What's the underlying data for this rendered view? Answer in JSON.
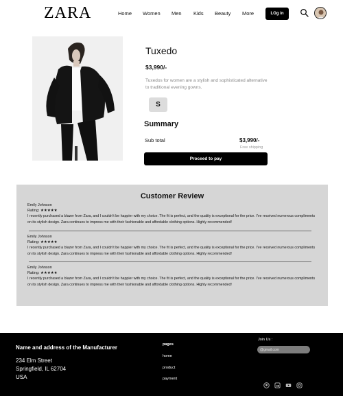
{
  "header": {
    "logo": "ZARA",
    "nav": [
      {
        "label": "Home"
      },
      {
        "label": "Women"
      },
      {
        "label": "Men"
      },
      {
        "label": "Kids"
      },
      {
        "label": "Beauty"
      },
      {
        "label": "More"
      }
    ],
    "login_label": "LOg in",
    "icons": {
      "search": "search-icon",
      "avatar": "avatar"
    }
  },
  "product": {
    "title": "Tuxedo",
    "price": "$3,990/-",
    "description": "Tuxedos for women are a stylish and sophisticated alternative to traditional evening gowns.",
    "size": "S"
  },
  "summary": {
    "title": "Summary",
    "subtotal_label": "Sub total",
    "subtotal_value": "$3,990/-",
    "shipping": "Free shipping",
    "proceed_label": "Proceed to  pay"
  },
  "reviews": {
    "title": "Customer Review",
    "items": [
      {
        "name": "Emily Johnson",
        "rating": "Rating: ★★★★★",
        "text": "I recently purchased a blazer from Zara, and I couldn't be happier with my choice. The fit is perfect, and the quality is exceptional for the price. I've received numerous compliments on its stylish design. Zara continues to impress me with their fashionable and affordable clothing options. Highly recommended!"
      },
      {
        "name": "Emily Johnson",
        "rating": "Rating: ★★★★★",
        "text": "I recently purchased a blazer from Zara, and I couldn't be happier with my choice. The fit is perfect, and the quality is exceptional for the price. I've received numerous compliments on its stylish design. Zara continues to impress me with their fashionable and affordable clothing options. Highly recommended!"
      },
      {
        "name": "Emily Johnson",
        "rating": "Rating: ★★★★★",
        "text": "I recently purchased a blazer from Zara, and I couldn't be happier with my choice. The fit is perfect, and the quality is exceptional for the price. I've received numerous compliments on its stylish design. Zara continues to impress me with their fashionable and affordable clothing options. Highly recommended!"
      }
    ]
  },
  "footer": {
    "manufacturer_title": "Name and address of the Manufacturer",
    "address": [
      "234 Elm Street",
      "Springfield, IL 62704",
      "USA"
    ],
    "pages_title": "pages",
    "links": [
      "home",
      "product",
      "payment"
    ],
    "join_label": "Join Us :",
    "email_placeholder": "@gmail.com",
    "social_icons": [
      "github-icon",
      "linkedin-icon",
      "youtube-icon",
      "instagram-icon"
    ]
  }
}
